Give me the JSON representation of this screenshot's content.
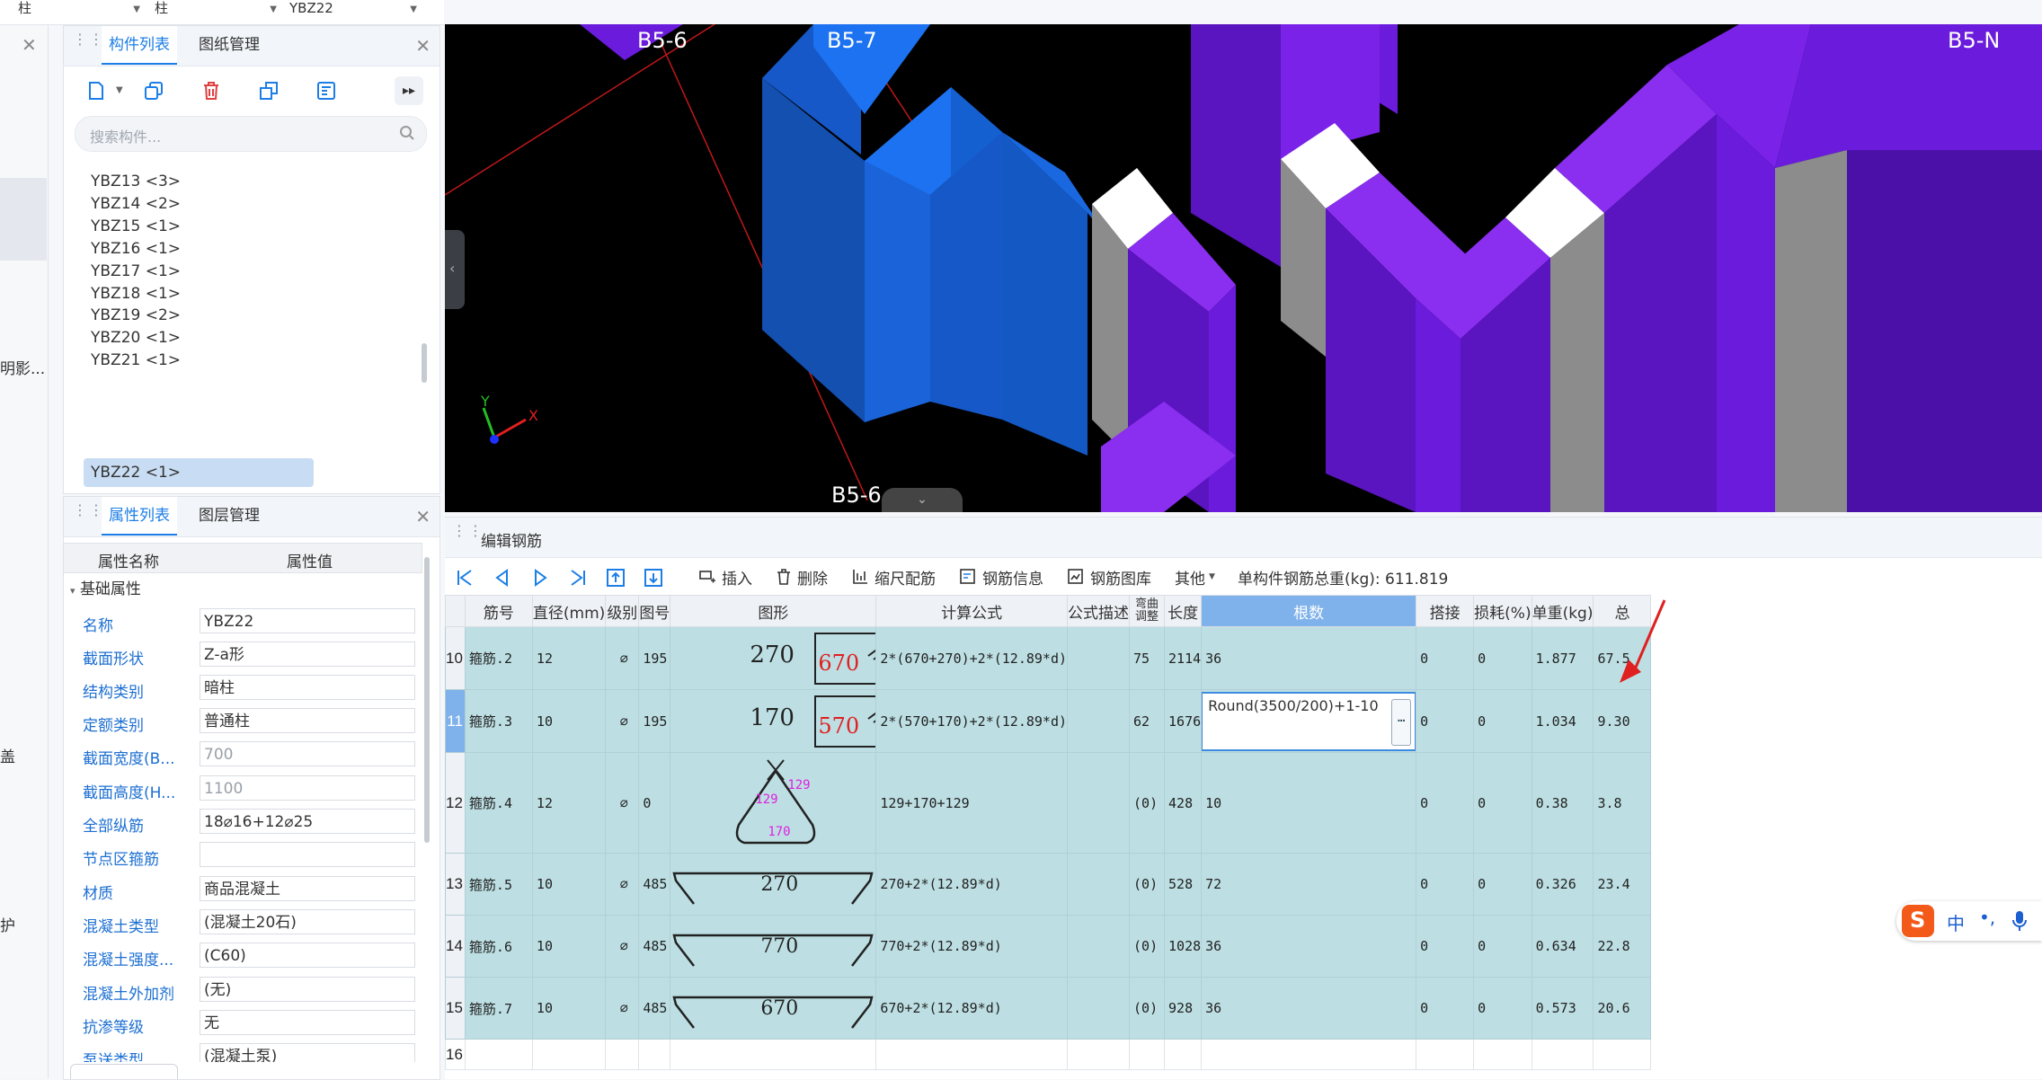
{
  "topbar": {
    "selects": [
      "柱",
      "柱",
      "YBZ22"
    ],
    "left_stub": "护"
  },
  "left_column": {
    "texts": [
      "明影...",
      "盖",
      "护"
    ]
  },
  "component_panel": {
    "tabs": [
      "构件列表",
      "图纸管理"
    ],
    "search_placeholder": "搜索构件...",
    "items": [
      {
        "label": "YBZ13 <3>"
      },
      {
        "label": "YBZ14 <2>"
      },
      {
        "label": "YBZ15 <1>"
      },
      {
        "label": "YBZ16 <1>"
      },
      {
        "label": "YBZ17 <1>"
      },
      {
        "label": "YBZ18 <1>"
      },
      {
        "label": "YBZ19 <2>"
      },
      {
        "label": "YBZ20 <1>"
      },
      {
        "label": "YBZ21 <1>"
      },
      {
        "label": "YBZ22 <1>"
      }
    ],
    "selected_item": "YBZ22 <1>"
  },
  "property_panel": {
    "tabs": [
      "属性列表",
      "图层管理"
    ],
    "header": [
      "属性名称",
      "属性值"
    ],
    "group": "基础属性",
    "rows": [
      {
        "name": "名称",
        "value": "YBZ22"
      },
      {
        "name": "截面形状",
        "value": "Z-a形"
      },
      {
        "name": "结构类别",
        "value": "暗柱"
      },
      {
        "name": "定额类别",
        "value": "普通柱"
      },
      {
        "name": "截面宽度(B...",
        "value": "700"
      },
      {
        "name": "截面高度(H...",
        "value": "1100"
      },
      {
        "name": "全部纵筋",
        "value": "18⌀16+12⌀25"
      },
      {
        "name": "节点区箍筋",
        "value": ""
      },
      {
        "name": "材质",
        "value": "商品混凝土"
      },
      {
        "name": "混凝土类型",
        "value": "(混凝土20石)"
      },
      {
        "name": "混凝土强度...",
        "value": "(C60)"
      },
      {
        "name": "混凝土外加剂",
        "value": "(无)"
      },
      {
        "name": "抗渗等级",
        "value": "无"
      },
      {
        "name": "泵送类型",
        "value": "(混凝土泵)"
      }
    ]
  },
  "viewport": {
    "grid_labels": [
      "B5-6",
      "B5-7",
      "B5-N",
      "B5-6"
    ],
    "axis": {
      "x": "X",
      "y": "Y"
    }
  },
  "editor": {
    "title": "编辑钢筋",
    "toolbar": {
      "insert": "插入",
      "delete": "删除",
      "scale_rebar": "缩尺配筋",
      "rebar_info": "钢筋信息",
      "rebar_library": "钢筋图库",
      "other": "其他",
      "total_label": "单构件钢筋总重(kg): 611.819"
    },
    "columns": [
      "筋号",
      "直径(mm)",
      "级别",
      "图号",
      "图形",
      "计算公式",
      "公式描述",
      "弯曲调整",
      "长度",
      "根数",
      "搭接",
      "损耗(%)",
      "单重(kg)",
      "总"
    ],
    "rows": [
      {
        "num": "10",
        "name": "箍筋.2",
        "dia": "12",
        "grade": "⌀",
        "fig": "195",
        "shape_a": "270",
        "shape_b": "670",
        "formula": "2*(670+270)+2*(12.89*d)",
        "desc": "",
        "bend": "75",
        "len": "2114",
        "count": "36",
        "lap": "0",
        "loss": "0",
        "unit": "1.877",
        "total": "67.5"
      },
      {
        "num": "11",
        "name": "箍筋.3",
        "dia": "10",
        "grade": "⌀",
        "fig": "195",
        "shape_a": "170",
        "shape_b": "570",
        "formula": "2*(570+170)+2*(12.89*d)",
        "desc": "",
        "bend": "62",
        "len": "1676",
        "count": "Round(3500/200)+1-10",
        "lap": "0",
        "loss": "0",
        "unit": "1.034",
        "total": "9.30"
      },
      {
        "num": "12",
        "name": "箍筋.4",
        "dia": "12",
        "grade": "⌀",
        "fig": "0",
        "shape_a": "129",
        "shape_b": "129",
        "shape_c": "170",
        "formula": "129+170+129",
        "desc": "",
        "bend": "(0)",
        "len": "428",
        "count": "10",
        "lap": "0",
        "loss": "0",
        "unit": "0.38",
        "total": "3.8"
      },
      {
        "num": "13",
        "name": "箍筋.5",
        "dia": "10",
        "grade": "⌀",
        "fig": "485",
        "shape_a": "270",
        "formula": "270+2*(12.89*d)",
        "desc": "",
        "bend": "(0)",
        "len": "528",
        "count": "72",
        "lap": "0",
        "loss": "0",
        "unit": "0.326",
        "total": "23.4"
      },
      {
        "num": "14",
        "name": "箍筋.6",
        "dia": "10",
        "grade": "⌀",
        "fig": "485",
        "shape_a": "770",
        "formula": "770+2*(12.89*d)",
        "desc": "",
        "bend": "(0)",
        "len": "1028",
        "count": "36",
        "lap": "0",
        "loss": "0",
        "unit": "0.634",
        "total": "22.8"
      },
      {
        "num": "15",
        "name": "箍筋.7",
        "dia": "10",
        "grade": "⌀",
        "fig": "485",
        "shape_a": "670",
        "formula": "670+2*(12.89*d)",
        "desc": "",
        "bend": "(0)",
        "len": "928",
        "count": "36",
        "lap": "0",
        "loss": "0",
        "unit": "0.573",
        "total": "20.6"
      },
      {
        "num": "16"
      }
    ]
  },
  "ime": {
    "label": "中"
  },
  "colors": {
    "accent": "#1c7ee6",
    "row_bg": "#bddfe3",
    "header_selected": "#7fb2ea",
    "purple": "#6a1bdc",
    "blue": "#1668e0"
  }
}
